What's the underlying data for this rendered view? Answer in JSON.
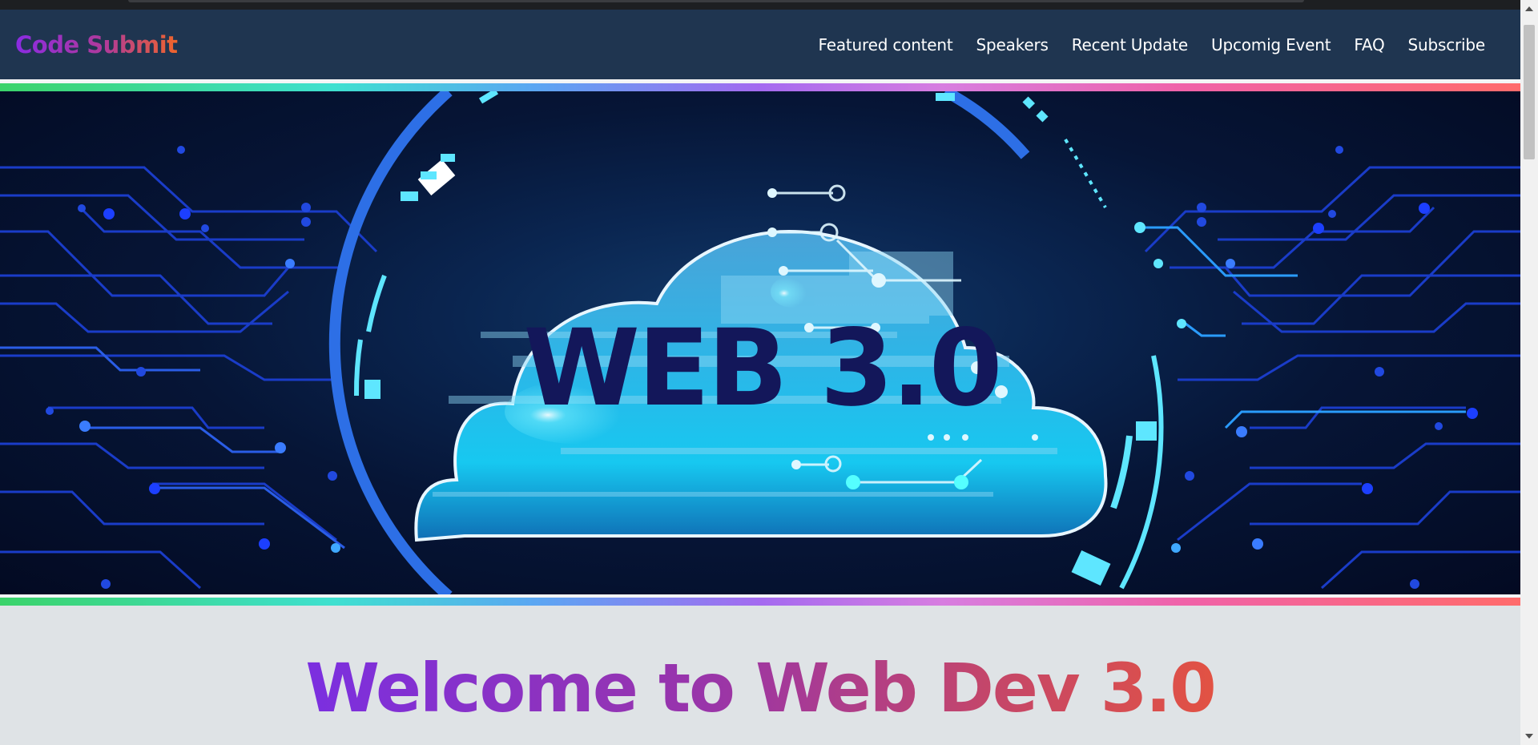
{
  "brand": {
    "name": "Code Submit"
  },
  "nav": {
    "items": [
      {
        "label": "Featured content"
      },
      {
        "label": "Speakers"
      },
      {
        "label": "Recent Update"
      },
      {
        "label": "Upcomig Event"
      },
      {
        "label": "FAQ"
      },
      {
        "label": "Subscribe"
      }
    ]
  },
  "hero": {
    "banner_text": "WEB 3.0"
  },
  "main": {
    "welcome_title": "Welcome to Web Dev 3.0"
  },
  "colors": {
    "navbar_bg": "#1f3550",
    "brand_gradient_start": "#8a2be2",
    "brand_gradient_end": "#f0652a",
    "page_bg": "#dfe3e6",
    "hero_text": "#13175a"
  }
}
